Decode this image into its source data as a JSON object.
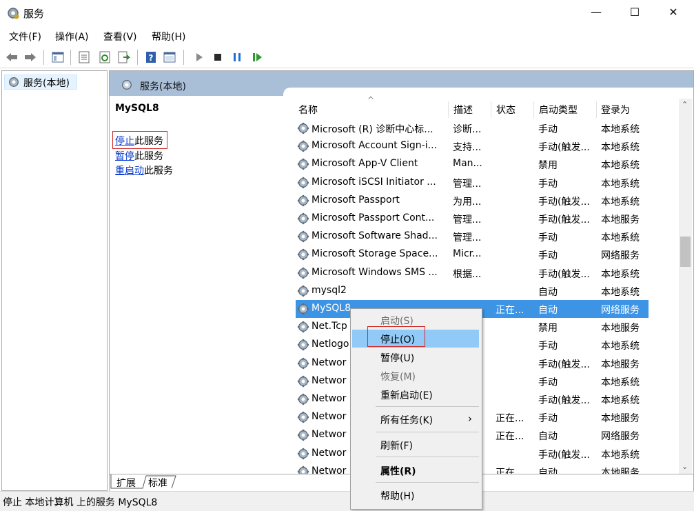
{
  "window": {
    "title": "服务",
    "minimize": "—",
    "maximize": "☐",
    "close": "✕"
  },
  "menu": [
    "文件(F)",
    "操作(A)",
    "查看(V)",
    "帮助(H)"
  ],
  "tree": {
    "item": "服务(本地)"
  },
  "header": {
    "title": "服务(本地)"
  },
  "action_pane": {
    "service_name": "MySQL8",
    "stop_link": "停止",
    "stop_suffix": "此服务",
    "pause_link": "暂停",
    "pause_suffix": "此服务",
    "restart_link": "重启动",
    "restart_suffix": "此服务"
  },
  "columns": {
    "name": "名称",
    "desc": "描述",
    "status": "状态",
    "startup": "启动类型",
    "logon": "登录为"
  },
  "rows": [
    {
      "name": "Microsoft (R) 诊断中心标...",
      "desc": "诊断...",
      "status": "",
      "startup": "手动",
      "logon": "本地系统"
    },
    {
      "name": "Microsoft Account Sign-i...",
      "desc": "支持...",
      "status": "",
      "startup": "手动(触发...",
      "logon": "本地系统"
    },
    {
      "name": "Microsoft App-V Client",
      "desc": "Man...",
      "status": "",
      "startup": "禁用",
      "logon": "本地系统"
    },
    {
      "name": "Microsoft iSCSI Initiator ...",
      "desc": "管理...",
      "status": "",
      "startup": "手动",
      "logon": "本地系统"
    },
    {
      "name": "Microsoft Passport",
      "desc": "为用...",
      "status": "",
      "startup": "手动(触发...",
      "logon": "本地系统"
    },
    {
      "name": "Microsoft Passport Cont...",
      "desc": "管理...",
      "status": "",
      "startup": "手动(触发...",
      "logon": "本地服务"
    },
    {
      "name": "Microsoft Software Shad...",
      "desc": "管理...",
      "status": "",
      "startup": "手动",
      "logon": "本地系统"
    },
    {
      "name": "Microsoft Storage Space...",
      "desc": "Micr...",
      "status": "",
      "startup": "手动",
      "logon": "网络服务"
    },
    {
      "name": "Microsoft Windows SMS ...",
      "desc": "根据...",
      "status": "",
      "startup": "手动(触发...",
      "logon": "本地系统"
    },
    {
      "name": "mysql2",
      "desc": "",
      "status": "",
      "startup": "自动",
      "logon": "本地系统"
    },
    {
      "name": "MySQL8",
      "desc": "",
      "status": "正在...",
      "startup": "自动",
      "logon": "网络服务"
    },
    {
      "name": "Net.Tcp",
      "desc": "",
      "status": "",
      "startup": "禁用",
      "logon": "本地服务"
    },
    {
      "name": "Netlogo",
      "desc": "",
      "status": "",
      "startup": "手动",
      "logon": "本地系统"
    },
    {
      "name": "Networ",
      "desc": "",
      "status": "",
      "startup": "手动(触发...",
      "logon": "本地服务"
    },
    {
      "name": "Networ",
      "desc": "",
      "status": "",
      "startup": "手动",
      "logon": "本地系统"
    },
    {
      "name": "Networ",
      "desc": "",
      "status": "",
      "startup": "手动(触发...",
      "logon": "本地系统"
    },
    {
      "name": "Networ",
      "desc": "",
      "status": "正在...",
      "startup": "手动",
      "logon": "本地服务"
    },
    {
      "name": "Networ",
      "desc": "",
      "status": "正在...",
      "startup": "自动",
      "logon": "网络服务"
    },
    {
      "name": "Networ",
      "desc": "",
      "status": "",
      "startup": "手动(触发...",
      "logon": "本地系统"
    },
    {
      "name": "Networ",
      "desc": "",
      "status": "正在...",
      "startup": "自动",
      "logon": "本地服务"
    }
  ],
  "selected_row": 10,
  "tabs": {
    "extended": "扩展",
    "standard": "标准"
  },
  "status_bar": "停止 本地计算机 上的服务 MySQL8",
  "context_menu": {
    "start": "启动(S)",
    "stop": "停止(O)",
    "pause": "暂停(U)",
    "resume": "恢复(M)",
    "restart": "重新启动(E)",
    "all_tasks": "所有任务(K)",
    "all_tasks_arrow": "›",
    "refresh": "刷新(F)",
    "properties": "属性(R)",
    "help": "帮助(H)"
  },
  "colors": {
    "selection": "#3d94e5",
    "menu_hover": "#91c9f7",
    "header_band": "#a9bed7",
    "highlight_box": "#d32a2a",
    "link": "#0033cc"
  },
  "icons": [
    "gear-icon",
    "back-arrow-icon",
    "forward-arrow-icon",
    "play-icon",
    "stop-icon",
    "pause-icon",
    "restart-icon",
    "help-icon"
  ]
}
